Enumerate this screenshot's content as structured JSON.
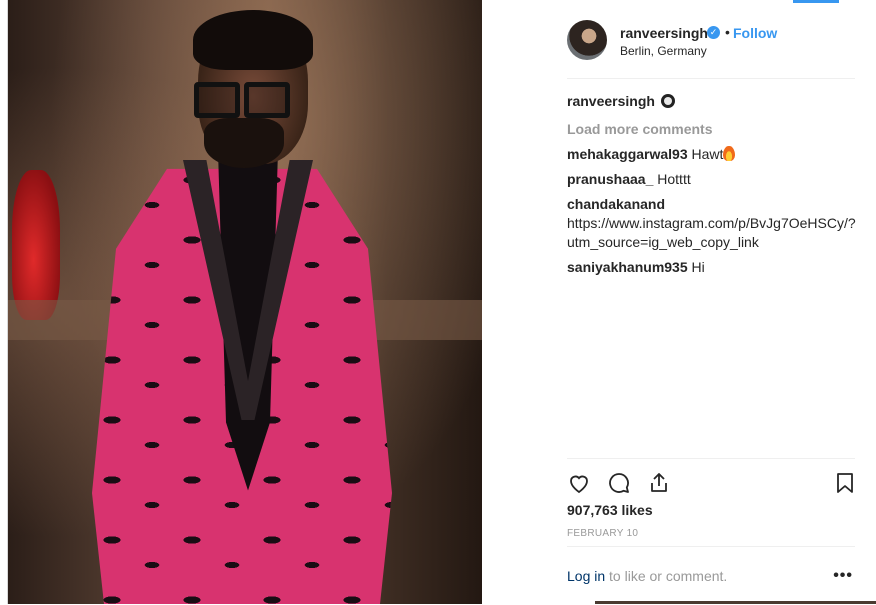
{
  "post": {
    "username": "ranveersingh",
    "verified_icon": "verified-badge-icon",
    "separator": "•",
    "follow_label": "Follow",
    "location": "Berlin, Germany",
    "photo_alt": "photo"
  },
  "comments": {
    "owner_username": "ranveersingh",
    "load_more": "Load more comments",
    "items": [
      {
        "user": "mehakaggarwal93",
        "text": "Hawt"
      },
      {
        "user": "pranushaaa_",
        "text": "Hotttt"
      },
      {
        "user": "chandakanand",
        "text": "https://www.instagram.com/p/BvJg7OeHSCy/?utm_source=ig_web_copy_link"
      },
      {
        "user": "saniyakhanum935",
        "text": "Hi"
      }
    ]
  },
  "stats": {
    "likes": "907,763 likes",
    "date": "FEBRUARY 10"
  },
  "footer": {
    "login_link": "Log in",
    "login_text": " to like or comment.",
    "more_label": "•••"
  },
  "colors": {
    "accent": "#3897f0",
    "link": "#003569",
    "muted": "#999999",
    "text": "#262626"
  }
}
